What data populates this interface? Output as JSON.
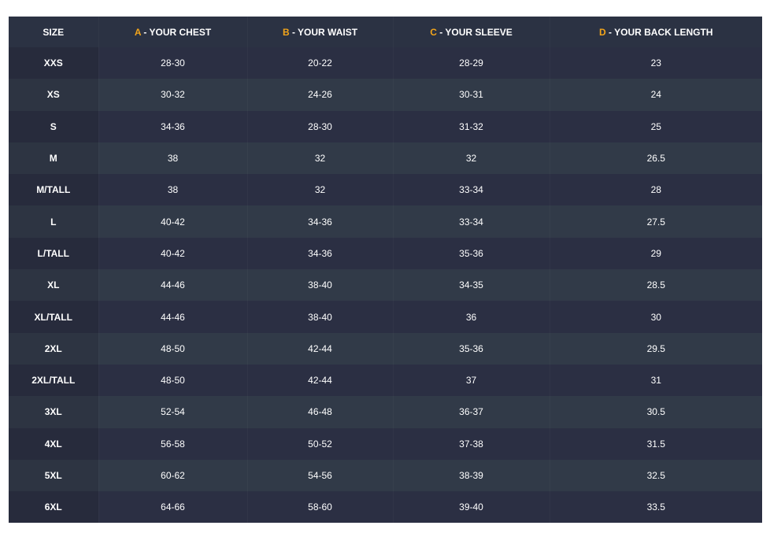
{
  "headers": [
    {
      "letter": "",
      "label": "SIZE"
    },
    {
      "letter": "A",
      "label": " - YOUR CHEST"
    },
    {
      "letter": "B",
      "label": " - YOUR WAIST"
    },
    {
      "letter": "C",
      "label": " - YOUR SLEEVE"
    },
    {
      "letter": "D",
      "label": " - YOUR BACK LENGTH"
    }
  ],
  "rows": [
    [
      "XXS",
      "28-30",
      "20-22",
      "28-29",
      "23"
    ],
    [
      "XS",
      "30-32",
      "24-26",
      "30-31",
      "24"
    ],
    [
      "S",
      "34-36",
      "28-30",
      "31-32",
      "25"
    ],
    [
      "M",
      "38",
      "32",
      "32",
      "26.5"
    ],
    [
      "M/TALL",
      "38",
      "32",
      "33-34",
      "28"
    ],
    [
      "L",
      "40-42",
      "34-36",
      "33-34",
      "27.5"
    ],
    [
      "L/TALL",
      "40-42",
      "34-36",
      "35-36",
      "29"
    ],
    [
      "XL",
      "44-46",
      "38-40",
      "34-35",
      "28.5"
    ],
    [
      "XL/TALL",
      "44-46",
      "38-40",
      "36",
      "30"
    ],
    [
      "2XL",
      "48-50",
      "42-44",
      "35-36",
      "29.5"
    ],
    [
      "2XL/TALL",
      "48-50",
      "42-44",
      "37",
      "31"
    ],
    [
      "3XL",
      "52-54",
      "46-48",
      "36-37",
      "30.5"
    ],
    [
      "4XL",
      "56-58",
      "50-52",
      "37-38",
      "31.5"
    ],
    [
      "5XL",
      "60-62",
      "54-56",
      "38-39",
      "32.5"
    ],
    [
      "6XL",
      "64-66",
      "58-60",
      "39-40",
      "33.5"
    ]
  ],
  "colors": {
    "header_bg": "#2b3243",
    "accent_letter": "#f3a51a",
    "row_odd": "#2b2f43",
    "row_even": "#313a48",
    "text": "#ffffff"
  }
}
